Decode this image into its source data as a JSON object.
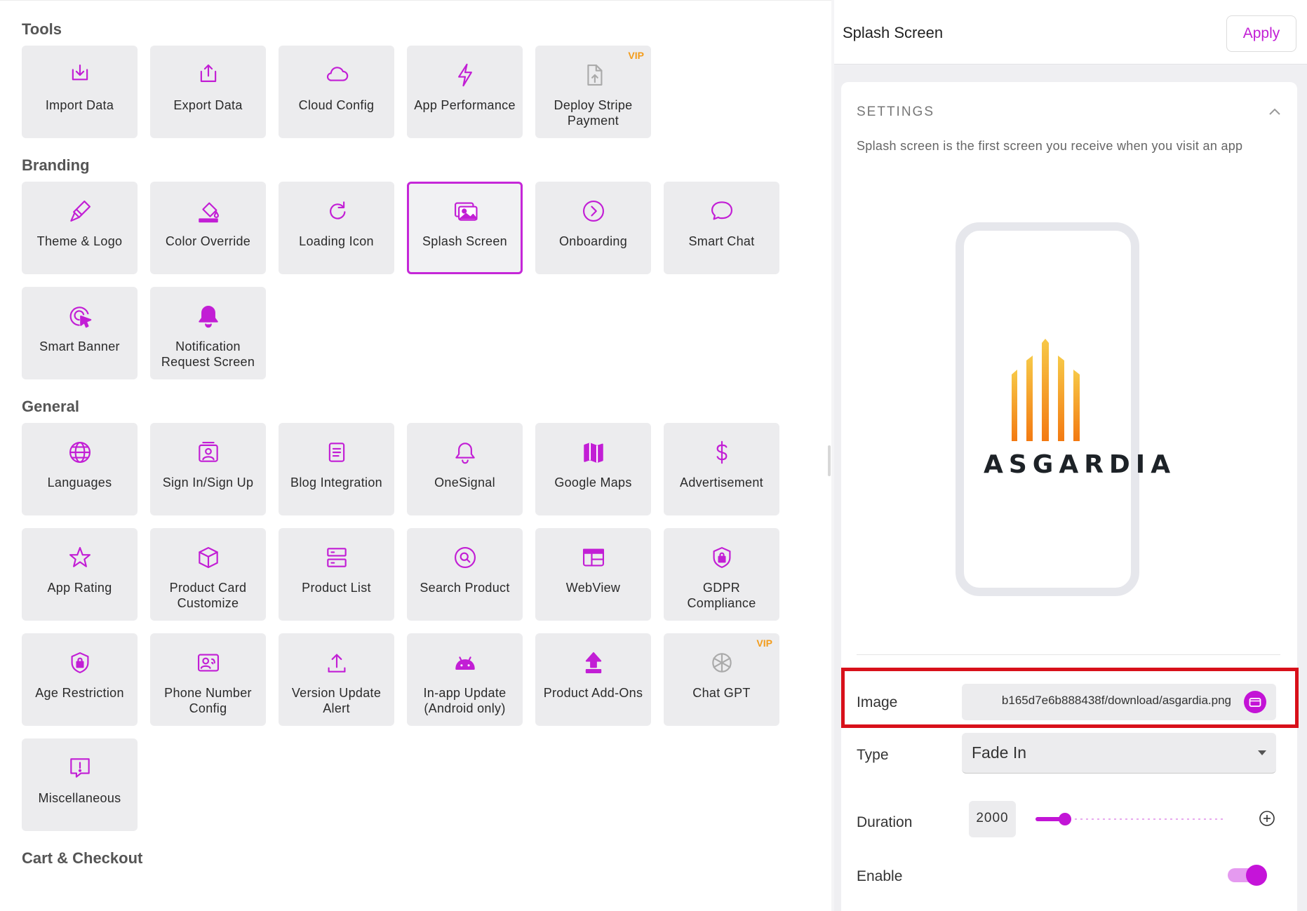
{
  "sections": [
    {
      "title": "Tools",
      "tiles": [
        {
          "label": "Import Data",
          "icon": "import-icon"
        },
        {
          "label": "Export Data",
          "icon": "export-icon"
        },
        {
          "label": "Cloud Config",
          "icon": "cloud-icon"
        },
        {
          "label": "App Performance",
          "icon": "lightning-icon"
        },
        {
          "label": "Deploy Stripe Payment",
          "icon": "file-upload-icon",
          "badge": "VIP"
        }
      ]
    },
    {
      "title": "Branding",
      "tiles": [
        {
          "label": "Theme & Logo",
          "icon": "brush-icon"
        },
        {
          "label": "Color Override",
          "icon": "paint-bucket-icon"
        },
        {
          "label": "Loading Icon",
          "icon": "refresh-icon"
        },
        {
          "label": "Splash Screen",
          "icon": "images-icon",
          "selected": true
        },
        {
          "label": "Onboarding",
          "icon": "play-circle-icon"
        },
        {
          "label": "Smart Chat",
          "icon": "chat-bubble-icon"
        },
        {
          "label": "Smart Banner",
          "icon": "cursor-click-icon"
        },
        {
          "label": "Notification Request Screen",
          "icon": "bell-filled-icon"
        }
      ]
    },
    {
      "title": "General",
      "tiles": [
        {
          "label": "Languages",
          "icon": "globe-icon"
        },
        {
          "label": "Sign In/Sign Up",
          "icon": "user-card-icon"
        },
        {
          "label": "Blog Integration",
          "icon": "document-icon"
        },
        {
          "label": "OneSignal",
          "icon": "bell-icon"
        },
        {
          "label": "Google Maps",
          "icon": "map-icon"
        },
        {
          "label": "Advertisement",
          "icon": "dollar-icon"
        },
        {
          "label": "App Rating",
          "icon": "star-icon"
        },
        {
          "label": "Product Card Customize",
          "icon": "cube-icon"
        },
        {
          "label": "Product List",
          "icon": "server-list-icon"
        },
        {
          "label": "Search Product",
          "icon": "search-icon"
        },
        {
          "label": "WebView",
          "icon": "browser-window-icon"
        },
        {
          "label": "GDPR Compliance",
          "icon": "shield-lock-icon"
        },
        {
          "label": "Age Restriction",
          "icon": "shield-lock-icon"
        },
        {
          "label": "Phone Number Config",
          "icon": "phone-contact-icon"
        },
        {
          "label": "Version Update Alert",
          "icon": "upload-tray-icon"
        },
        {
          "label": "In-app Update (Android only)",
          "icon": "android-icon"
        },
        {
          "label": "Product Add-Ons",
          "icon": "upload-arrow-icon"
        },
        {
          "label": "Chat GPT",
          "icon": "openai-icon",
          "badge": "VIP"
        },
        {
          "label": "Miscellaneous",
          "icon": "alert-message-icon"
        }
      ]
    },
    {
      "title": "Cart & Checkout",
      "tiles": []
    }
  ],
  "panel": {
    "title": "Splash Screen",
    "apply_label": "Apply",
    "settings_title": "SETTINGS",
    "description": "Splash screen is the first screen you receive when you visit an app",
    "preview_logo_text": "ASGARDIA",
    "image_label": "Image",
    "image_value": "b165d7e6b888438f/download/asgardia.png",
    "type_label": "Type",
    "type_value": "Fade In",
    "duration_label": "Duration",
    "duration_value": "2000",
    "duration_fraction": 0.09,
    "enable_label": "Enable",
    "enabled": true
  },
  "colors": {
    "accent": "#c21ed5",
    "vip": "#f39c1b",
    "highlight": "#d8101a"
  }
}
